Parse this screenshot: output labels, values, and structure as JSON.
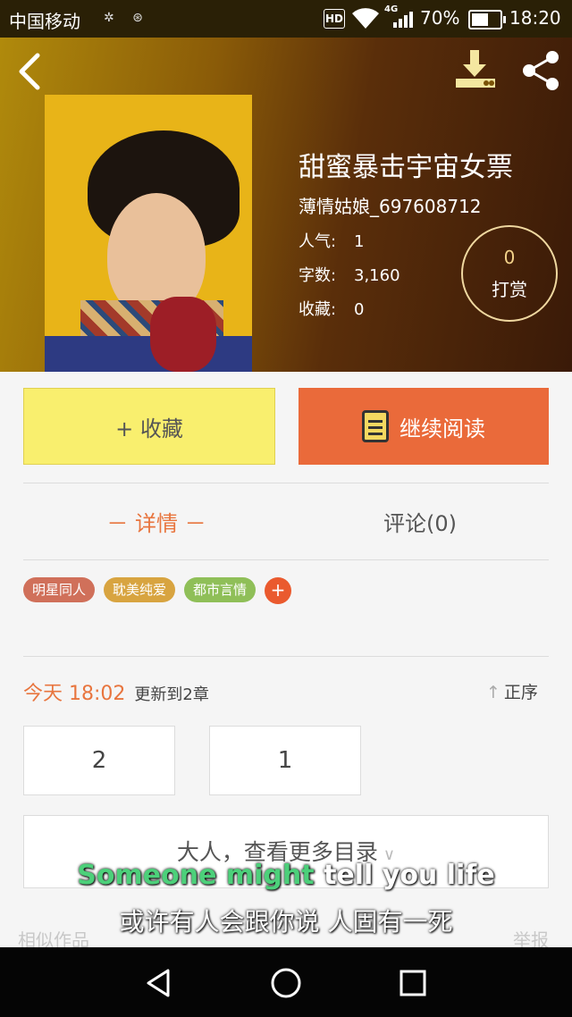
{
  "status_bar": {
    "carrier": "中国移动",
    "hd_badge": "HD",
    "network": "4G",
    "battery_percent": "70%",
    "battery_level": 0.7,
    "time": "18:20"
  },
  "book": {
    "title": "甜蜜暴击宇宙女票",
    "author": "薄情姑娘_697608712",
    "stats": [
      {
        "label": "人气:",
        "value": "1"
      },
      {
        "label": "字数:",
        "value": "3,160"
      },
      {
        "label": "收藏:",
        "value": "0"
      }
    ],
    "tip_count": "0",
    "tip_label": "打赏"
  },
  "actions": {
    "favorite_label": "+ 收藏",
    "continue_label": "继续阅读"
  },
  "tabs": {
    "detail": "－ 详情 －",
    "comments": "评论(0)"
  },
  "tags": [
    {
      "label": "明星同人",
      "color": "#d0705a"
    },
    {
      "label": "耽美纯爱",
      "color": "#d8a440"
    },
    {
      "label": "都市言情",
      "color": "#8fbf58"
    }
  ],
  "tag_add": "+",
  "update": {
    "prefix": "今天 18:02",
    "text": "更新到2章"
  },
  "sort_label": "正序",
  "chapters": [
    "2",
    "1"
  ],
  "more_catalog": "大人，查看更多目录",
  "similar_label": "相似作品",
  "report_label": "举报",
  "subtitles": {
    "en_highlight": "Someone might",
    "en_rest": "tell you life",
    "zh": "或许有人会跟你说 人固有一死"
  },
  "colors": {
    "accent": "#e8753e",
    "favorite_bg": "#f9ef6e",
    "read_bg": "#ea6a3a"
  }
}
